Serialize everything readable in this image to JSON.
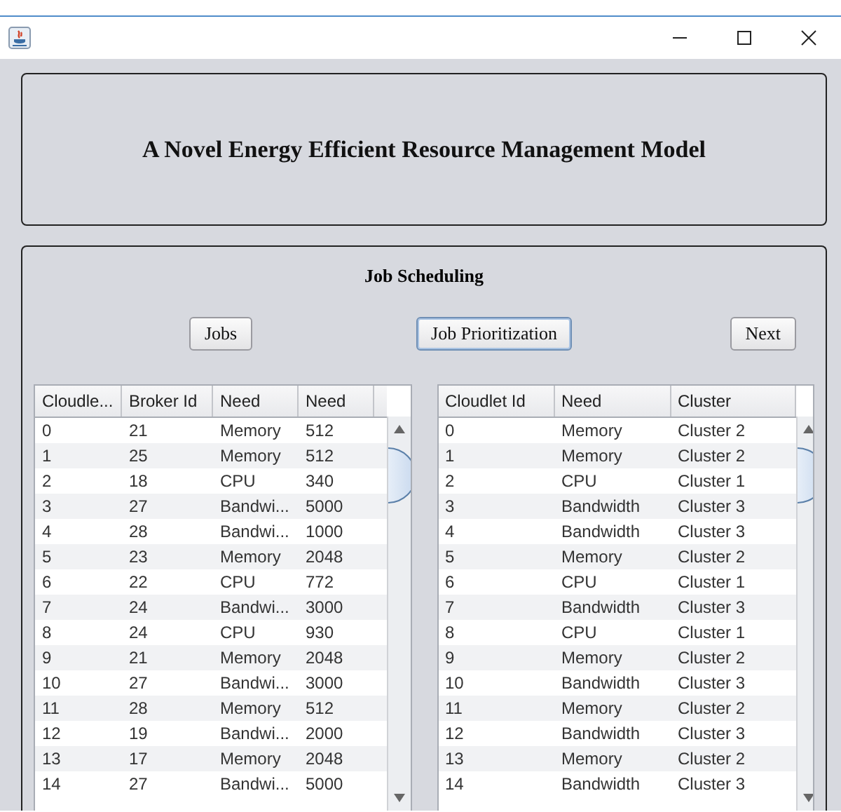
{
  "header": {
    "title": "A Novel Energy Efficient Resource Management Model"
  },
  "section": {
    "title": "Job Scheduling"
  },
  "buttons": [
    {
      "label": "Jobs",
      "focused": false
    },
    {
      "label": "Job Prioritization",
      "focused": true
    },
    {
      "label": "Next",
      "focused": false
    }
  ],
  "tables": [
    {
      "columns": [
        "Cloudle...",
        "Broker Id",
        "Need",
        "Need"
      ],
      "rows": [
        [
          "0",
          "21",
          "Memory",
          "512"
        ],
        [
          "1",
          "25",
          "Memory",
          "512"
        ],
        [
          "2",
          "18",
          "CPU",
          "340"
        ],
        [
          "3",
          "27",
          "Bandwi...",
          "5000"
        ],
        [
          "4",
          "28",
          "Bandwi...",
          "1000"
        ],
        [
          "5",
          "23",
          "Memory",
          "2048"
        ],
        [
          "6",
          "22",
          "CPU",
          "772"
        ],
        [
          "7",
          "24",
          "Bandwi...",
          "3000"
        ],
        [
          "8",
          "24",
          "CPU",
          "930"
        ],
        [
          "9",
          "21",
          "Memory",
          "2048"
        ],
        [
          "10",
          "27",
          "Bandwi...",
          "3000"
        ],
        [
          "11",
          "28",
          "Memory",
          "512"
        ],
        [
          "12",
          "19",
          "Bandwi...",
          "2000"
        ],
        [
          "13",
          "17",
          "Memory",
          "2048"
        ],
        [
          "14",
          "27",
          "Bandwi...",
          "5000"
        ]
      ]
    },
    {
      "columns": [
        "Cloudlet Id",
        "Need",
        "Cluster"
      ],
      "rows": [
        [
          "0",
          "Memory",
          "Cluster 2"
        ],
        [
          "1",
          "Memory",
          "Cluster 2"
        ],
        [
          "2",
          "CPU",
          "Cluster 1"
        ],
        [
          "3",
          "Bandwidth",
          "Cluster 3"
        ],
        [
          "4",
          "Bandwidth",
          "Cluster 3"
        ],
        [
          "5",
          "Memory",
          "Cluster 2"
        ],
        [
          "6",
          "CPU",
          "Cluster 1"
        ],
        [
          "7",
          "Bandwidth",
          "Cluster 3"
        ],
        [
          "8",
          "CPU",
          "Cluster 1"
        ],
        [
          "9",
          "Memory",
          "Cluster 2"
        ],
        [
          "10",
          "Bandwidth",
          "Cluster 3"
        ],
        [
          "11",
          "Memory",
          "Cluster 2"
        ],
        [
          "12",
          "Bandwidth",
          "Cluster 3"
        ],
        [
          "13",
          "Memory",
          "Cluster 2"
        ],
        [
          "14",
          "Bandwidth",
          "Cluster 3"
        ]
      ]
    }
  ]
}
